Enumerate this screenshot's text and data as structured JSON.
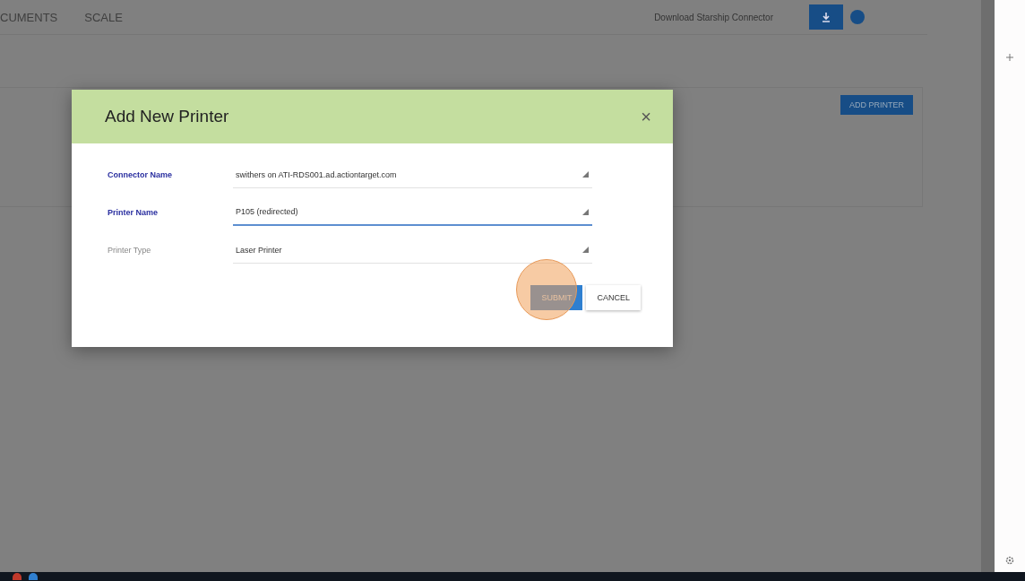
{
  "nav": {
    "tabs": [
      {
        "label": "CUMENTS",
        "selected": false
      },
      {
        "label": "SCALE",
        "selected": false
      }
    ],
    "download_label": "Download Starship Connector"
  },
  "card": {
    "button": "ADD PRINTER"
  },
  "dialog": {
    "title": "Add New Printer",
    "close": "×",
    "fields": [
      {
        "label": "Connector Name",
        "value": "swithers on ATI-RDS001.ad.actiontarget.com",
        "highlighted": true,
        "focused": false
      },
      {
        "label": "Printer Name",
        "value": "P105 (redirected)",
        "highlighted": true,
        "focused": true
      },
      {
        "label": "Printer Type",
        "value": "Laser Printer",
        "highlighted": false,
        "focused": false
      }
    ],
    "buttons": [
      {
        "label": "SUBMIT",
        "kind": "primary"
      },
      {
        "label": "CANCEL",
        "kind": "secondary"
      }
    ],
    "click_marker": true
  }
}
